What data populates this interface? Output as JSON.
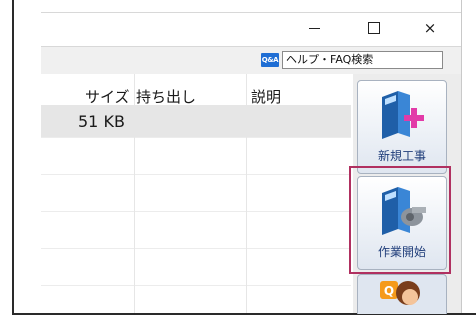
{
  "window": {
    "controls": {
      "minimize": "–",
      "maximize": "□",
      "close": "×"
    }
  },
  "help": {
    "faq_badge": "Q&A",
    "search_value": "ヘルプ・FAQ検索"
  },
  "list": {
    "columns": [
      "サイズ",
      "持ち出し",
      "説明"
    ],
    "rows": [
      {
        "size": "51 KB",
        "carry_out": "",
        "description": ""
      }
    ]
  },
  "toolbar": {
    "buttons": [
      {
        "label": "新規工事",
        "icon": "book-plus-icon"
      },
      {
        "label": "作業開始",
        "icon": "book-whistle-icon"
      },
      {
        "label": "",
        "icon": "support-person-icon"
      }
    ],
    "accent_color": "#b03060"
  }
}
